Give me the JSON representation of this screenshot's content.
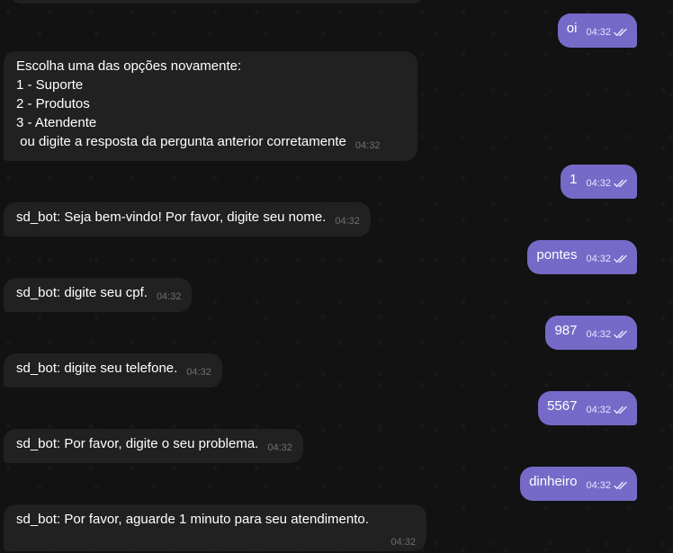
{
  "messages": [
    {
      "id": "m1",
      "direction": "out",
      "text": "oi",
      "time": "04:32"
    },
    {
      "id": "m2",
      "direction": "in",
      "lines": [
        "Escolha uma das opções novamente:",
        "1 - Suporte",
        "2 - Produtos",
        "3 - Atendente",
        " ou digite a resposta da pergunta anterior corretamente"
      ],
      "time": "04:32"
    },
    {
      "id": "m3",
      "direction": "out",
      "text": "1",
      "time": "04:32"
    },
    {
      "id": "m4",
      "direction": "in",
      "text": "sd_bot: Seja bem-vindo! Por favor, digite seu nome.",
      "time": "04:32"
    },
    {
      "id": "m5",
      "direction": "out",
      "text": "pontes",
      "time": "04:32"
    },
    {
      "id": "m6",
      "direction": "in",
      "text": "sd_bot: digite seu cpf.",
      "time": "04:32"
    },
    {
      "id": "m7",
      "direction": "out",
      "text": "987",
      "time": "04:32"
    },
    {
      "id": "m8",
      "direction": "in",
      "text": "sd_bot: digite seu telefone.",
      "time": "04:32"
    },
    {
      "id": "m9",
      "direction": "out",
      "text": "5567",
      "time": "04:32"
    },
    {
      "id": "m10",
      "direction": "in",
      "text": "sd_bot: Por favor, digite o seu problema.",
      "time": "04:32"
    },
    {
      "id": "m11",
      "direction": "out",
      "text": "dinheiro",
      "time": "04:32"
    },
    {
      "id": "m12",
      "direction": "in",
      "text": "sd_bot: Por favor, aguarde 1 minuto para seu atendimento.",
      "time": "04:32"
    }
  ],
  "colors": {
    "background": "#121212",
    "incoming_bubble": "#212121",
    "outgoing_bubble": "#766ac8",
    "incoming_time": "#6f6f6f",
    "outgoing_time": "#e6e2ff"
  },
  "icons": {
    "read_status": "double-check-icon"
  }
}
